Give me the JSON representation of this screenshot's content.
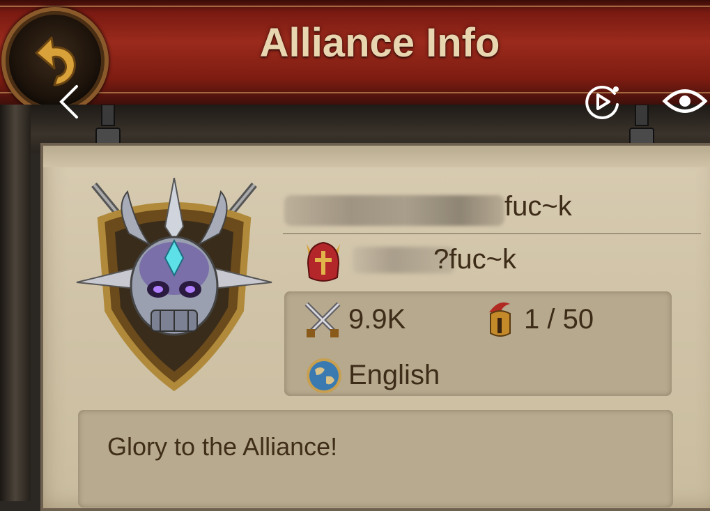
{
  "header": {
    "title": "Alliance Info"
  },
  "alliance": {
    "name_visible": "fuc~k",
    "leader_visible": "?fuc~k"
  },
  "stats": {
    "power": "9.9K",
    "members": "1 / 50",
    "language": "English"
  },
  "description": "Glory to the Alliance!",
  "overlay": {
    "icons": [
      "back-chevron-icon",
      "replay-icon",
      "eye-icon"
    ]
  },
  "colors": {
    "header_red": "#9a2a1c",
    "panel_parchment": "#d7cbb1",
    "text_brown": "#3d2c18"
  }
}
